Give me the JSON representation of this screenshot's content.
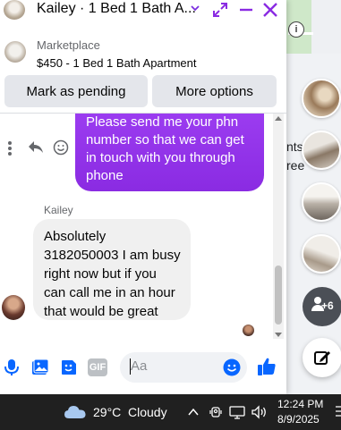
{
  "background": {
    "text_partial_1": "nts",
    "text_partial_2": "ree",
    "more_contacts": "+6"
  },
  "chat": {
    "title": "Kailey · 1 Bed 1 Bath A...",
    "listing": {
      "category": "Marketplace",
      "name": "$450 - 1 Bed 1 Bath Apartment"
    },
    "actions": {
      "mark_pending": "Mark as pending",
      "more_options": "More options"
    },
    "messages": {
      "outgoing_lines": [
        "Please send me your phn",
        "number so that we can get",
        "in touch with you through",
        "phone"
      ],
      "sender_name": "Kailey",
      "incoming_lines": [
        "Absolutely",
        "3182050003 I am busy",
        "right now but if you",
        "can call me in an hour",
        "that would be great"
      ]
    },
    "composer": {
      "placeholder": "Aa",
      "gif_label": "GIF"
    },
    "accent_color": "#0866ff",
    "outgoing_color": "#9b3cf0"
  },
  "taskbar": {
    "temperature": "29°C",
    "condition": "Cloudy",
    "time": "12:24 PM",
    "date": "8/9/2025"
  }
}
